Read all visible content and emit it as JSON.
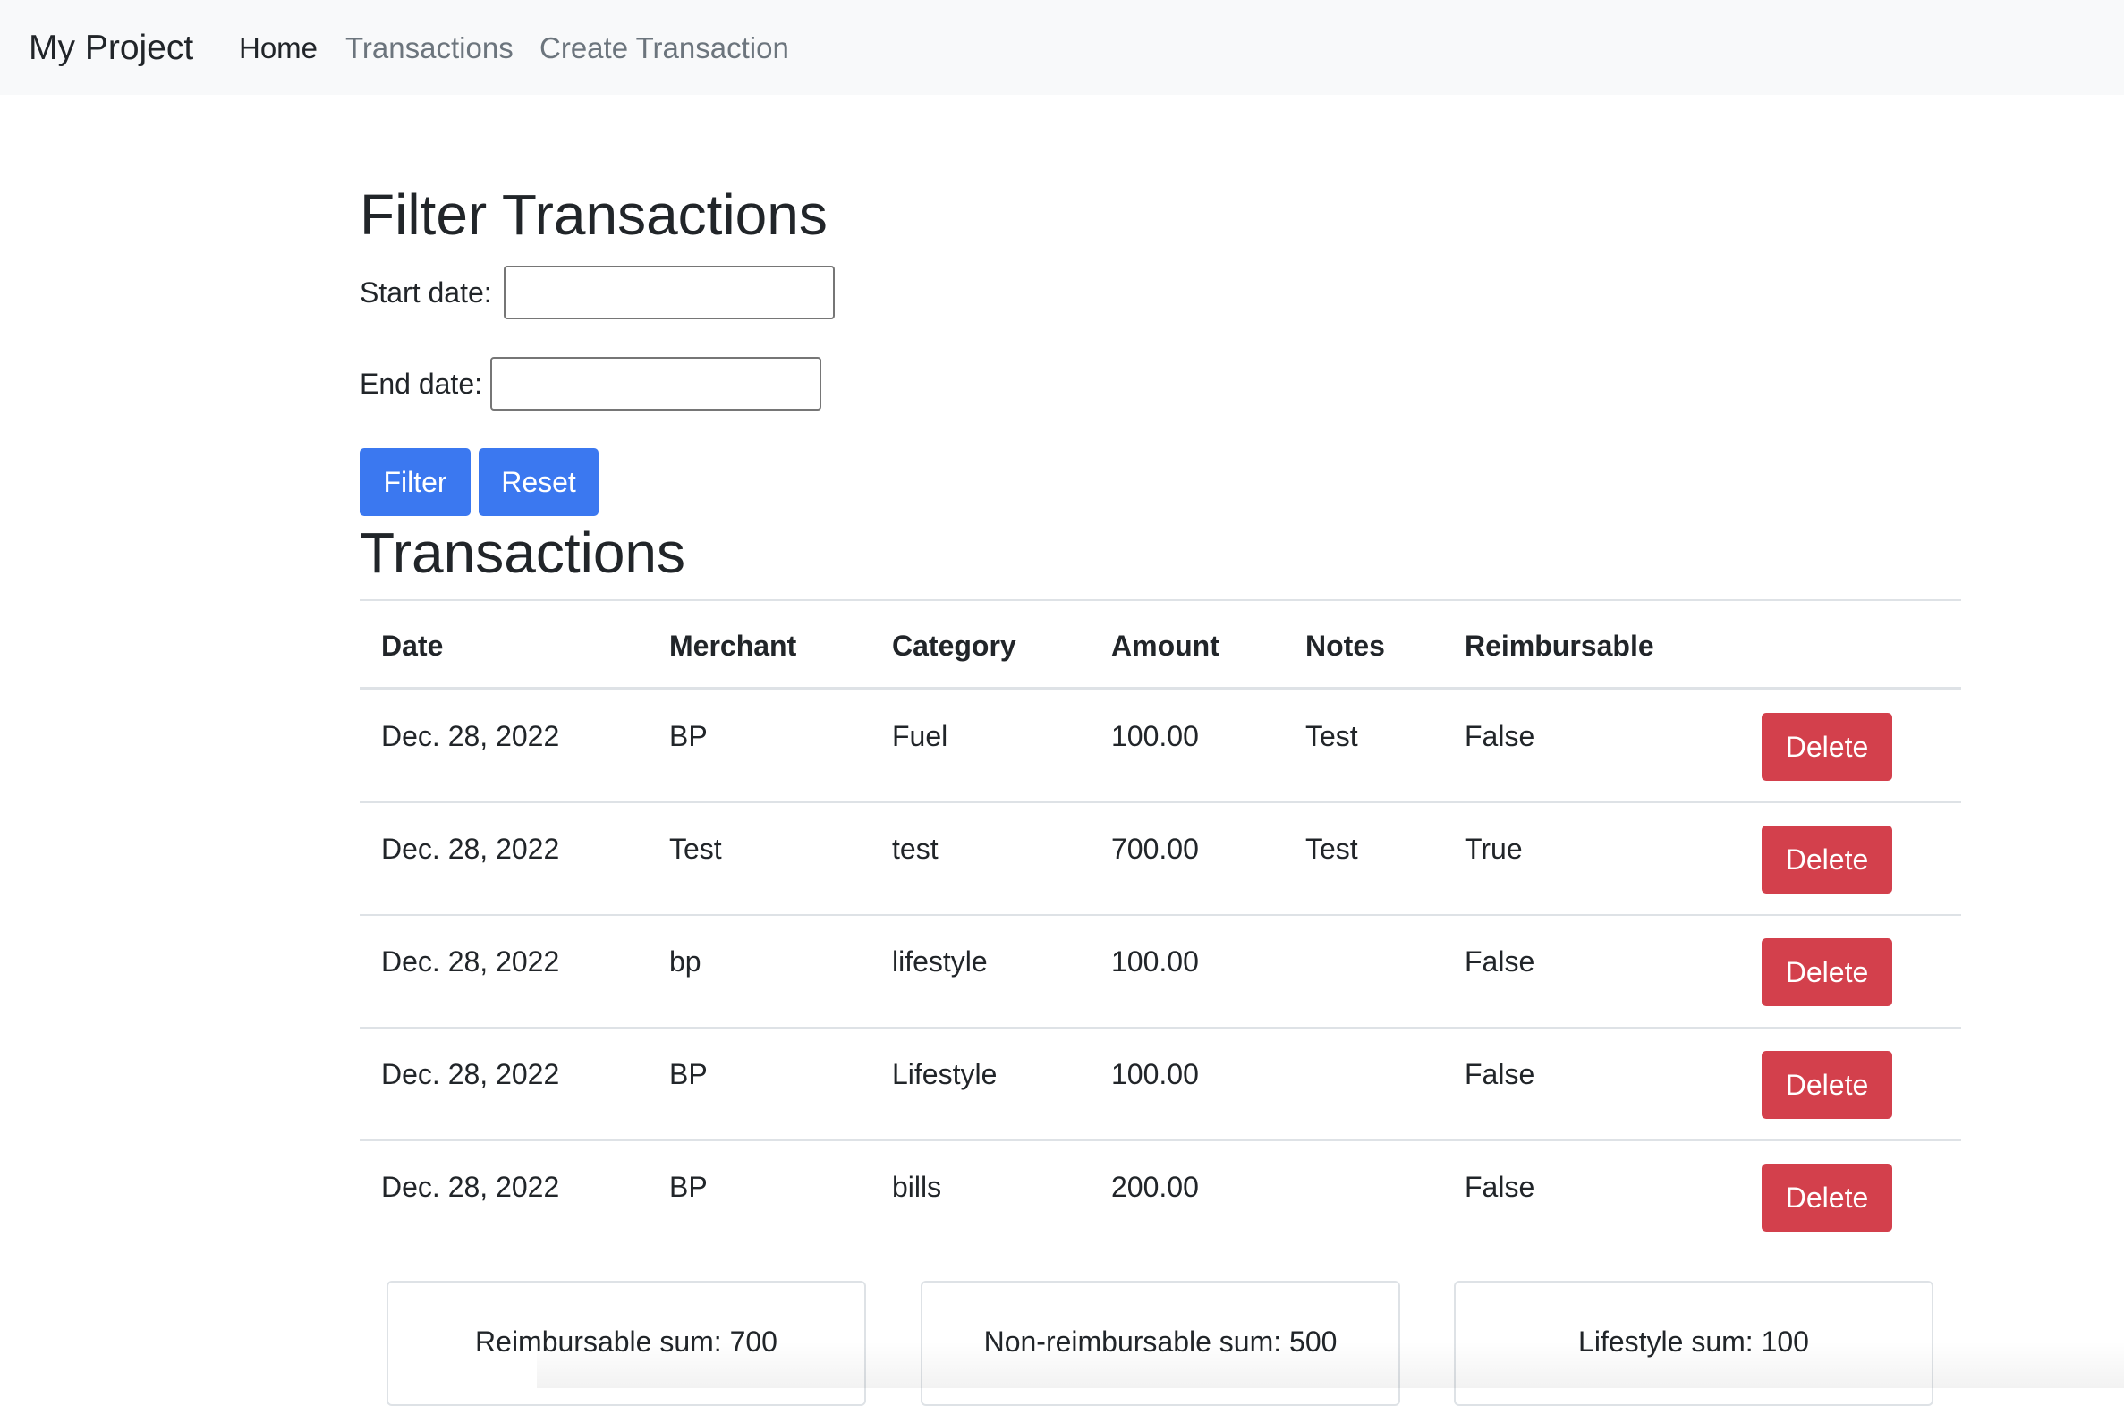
{
  "navbar": {
    "brand": "My Project",
    "links": [
      {
        "label": "Home",
        "active": true
      },
      {
        "label": "Transactions",
        "active": false
      },
      {
        "label": "Create Transaction",
        "active": false
      }
    ]
  },
  "filter": {
    "title": "Filter Transactions",
    "start_label": "Start date:",
    "start_value": "",
    "end_label": "End date:",
    "end_value": "",
    "filter_button": "Filter",
    "reset_button": "Reset"
  },
  "transactions": {
    "title": "Transactions",
    "columns": [
      "Date",
      "Merchant",
      "Category",
      "Amount",
      "Notes",
      "Reimbursable"
    ],
    "delete_label": "Delete",
    "rows": [
      {
        "date": "Dec. 28, 2022",
        "merchant": "BP",
        "category": "Fuel",
        "amount": "100.00",
        "notes": "Test",
        "reimbursable": "False"
      },
      {
        "date": "Dec. 28, 2022",
        "merchant": "Test",
        "category": "test",
        "amount": "700.00",
        "notes": "Test",
        "reimbursable": "True"
      },
      {
        "date": "Dec. 28, 2022",
        "merchant": "bp",
        "category": "lifestyle",
        "amount": "100.00",
        "notes": "",
        "reimbursable": "False"
      },
      {
        "date": "Dec. 28, 2022",
        "merchant": "BP",
        "category": "Lifestyle",
        "amount": "100.00",
        "notes": "",
        "reimbursable": "False"
      },
      {
        "date": "Dec. 28, 2022",
        "merchant": "BP",
        "category": "bills",
        "amount": "200.00",
        "notes": "",
        "reimbursable": "False"
      }
    ]
  },
  "summary": {
    "reimbursable": "Reimbursable sum: 700",
    "non_reimbursable": "Non-reimbursable sum: 500",
    "lifestyle": "Lifestyle sum: 100"
  },
  "colors": {
    "primary": "#3b78f0",
    "danger": "#d3404c",
    "navbar_bg": "#f8f9fa"
  }
}
